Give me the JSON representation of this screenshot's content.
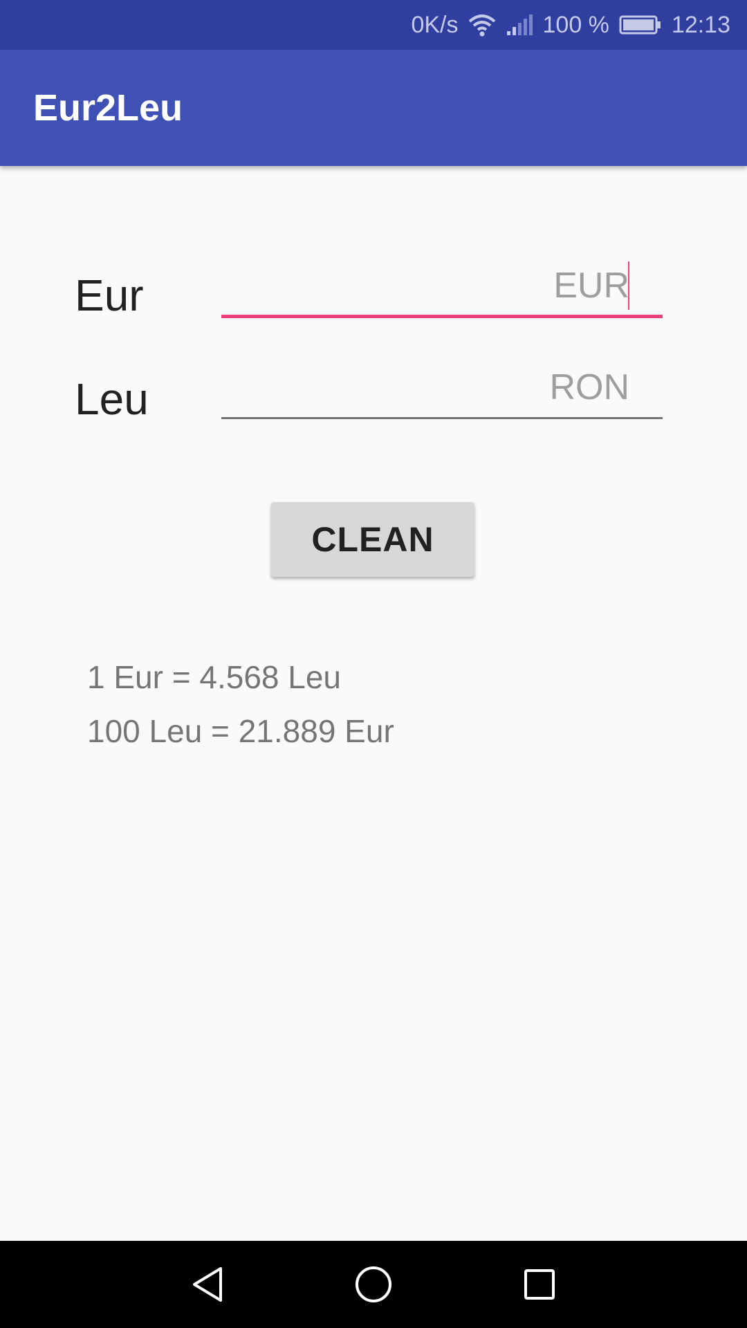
{
  "status_bar": {
    "net_speed": "0K/s",
    "battery_percent": "100 %",
    "time": "12:13",
    "icons": [
      "wifi-icon",
      "signal-icon",
      "battery-icon"
    ]
  },
  "app_bar": {
    "title": "Eur2Leu",
    "color": "#3f51b5"
  },
  "converter": {
    "eur_label": "Eur",
    "eur_placeholder": "EUR",
    "eur_value": "",
    "leu_label": "Leu",
    "leu_placeholder": "RON",
    "leu_value": ""
  },
  "clean_button": {
    "label": "CLEAN"
  },
  "rates": {
    "eur_to_leu": "1 Eur = 4.568 Leu",
    "leu_to_eur": "100 Leu = 21.889 Eur"
  },
  "nav_bar": {
    "icons": [
      "back-icon",
      "home-icon",
      "recents-icon"
    ]
  },
  "colors": {
    "accent": "#ec407a",
    "primary_dark": "#303f9f"
  }
}
